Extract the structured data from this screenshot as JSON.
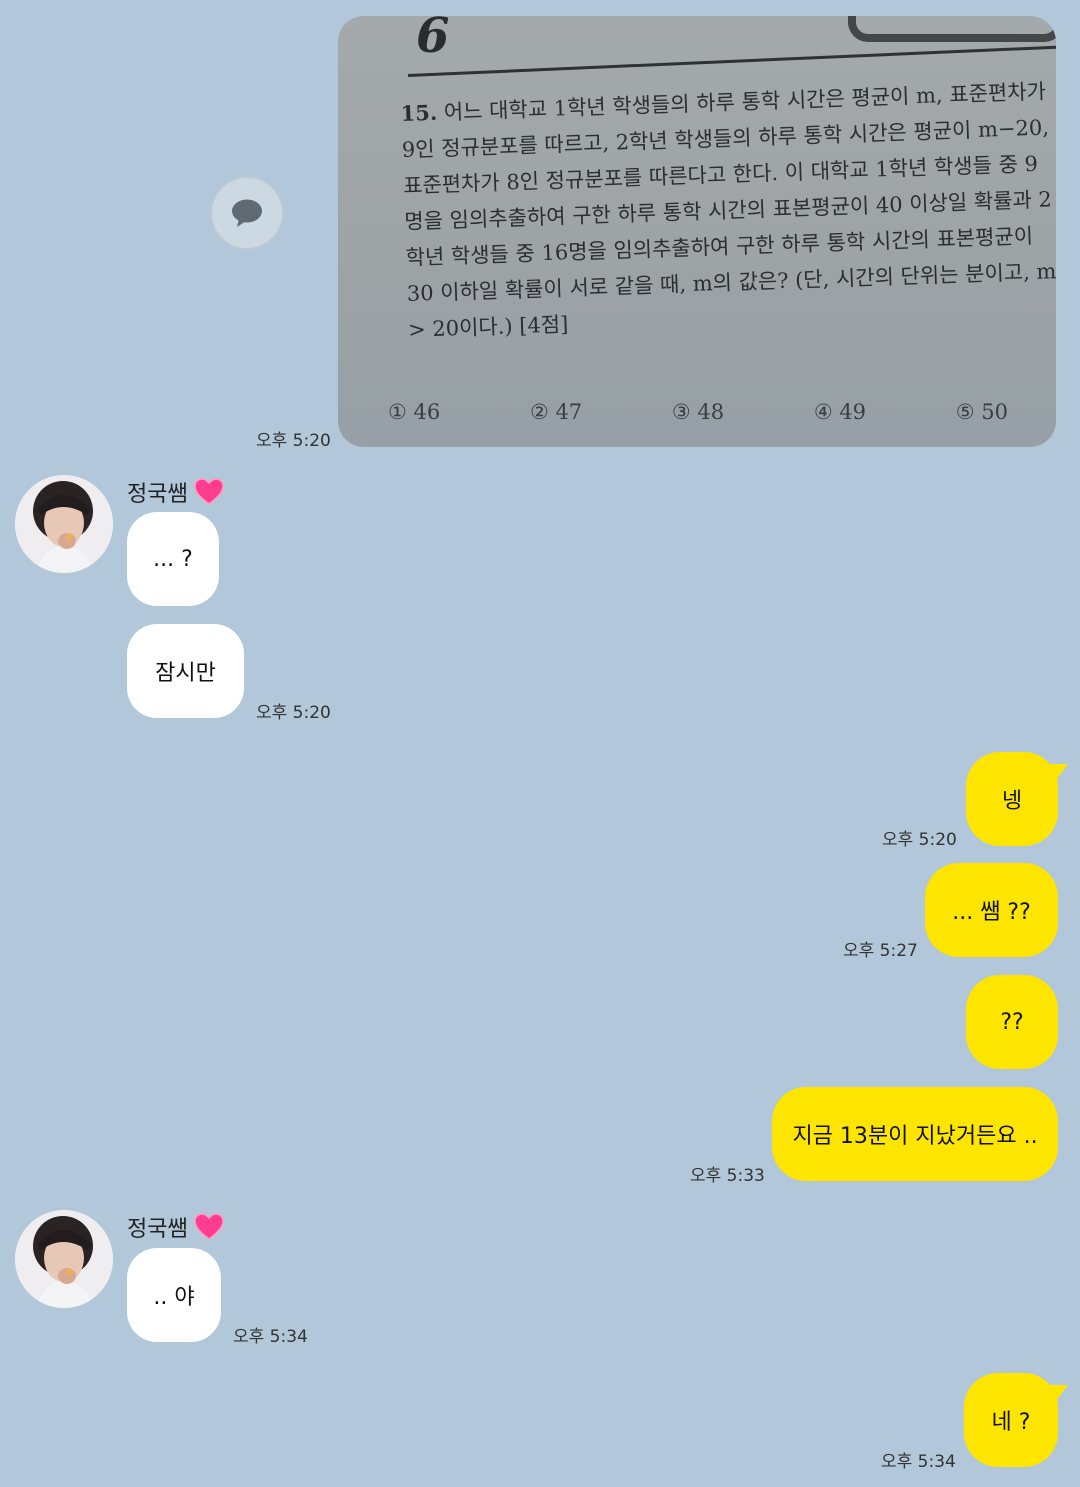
{
  "photo": {
    "page_number": "6",
    "problem_number": "15.",
    "problem_text": "어느 대학교 1학년 학생들의 하루 통학 시간은 평균이 m, 표준편차가 9인 정규분포를 따르고, 2학년 학생들의 하루 통학 시간은 평균이 m−20, 표준편차가 8인 정규분포를 따른다고 한다. 이 대학교 1학년 학생들 중 9명을 임의추출하여 구한 하루 통학 시간의 표본평균이 40 이상일 확률과 2학년 학생들 중 16명을 임의추출하여 구한 하루 통학 시간의 표본평균이 30 이하일 확률이 서로 같을 때, m의 값은? (단, 시간의 단위는 분이고, m > 20이다.) [4점]",
    "choices": [
      "① 46",
      "② 47",
      "③ 48",
      "④ 49",
      "⑤ 50"
    ],
    "time": "오후 5:20"
  },
  "share_icon": "speech-bubble-icon",
  "sender": {
    "name": "정국쌤",
    "emoji": "heart-icon"
  },
  "messages": {
    "m1": "... ?",
    "m2": "잠시만",
    "m2_time": "오후 5:20",
    "m3": "넹",
    "m3_time": "오후 5:20",
    "m4": "... 쌤 ??",
    "m4_time": "오후 5:27",
    "m5": "??",
    "m6": "지금 13분이 지났거든요 ..",
    "m6_time": "오후 5:33",
    "m7": ".. 야",
    "m7_time": "오후 5:34",
    "m8": "네 ?",
    "m8_time": "오후 5:34"
  },
  "colors": {
    "background": "#b2c7d9",
    "my_bubble": "#fee500",
    "their_bubble": "#ffffff"
  }
}
